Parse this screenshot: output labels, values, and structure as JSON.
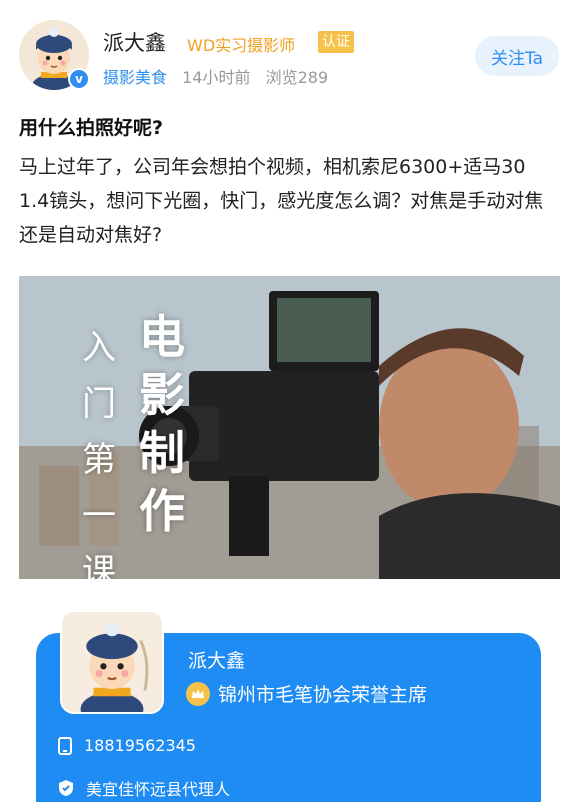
{
  "author": {
    "name": "派大鑫",
    "title": "WD实习摄影师",
    "cert_tag": "认证",
    "verify_icon": "v",
    "category": "摄影美食",
    "time": "14小时前",
    "views": "浏览289"
  },
  "follow_label": "关注Ta",
  "post": {
    "title": "用什么拍照好呢?",
    "body": "马上过年了，公司年会想拍个视频，相机索尼6300+适马30 1.4镜头，想问下光圈，快门，感光度怎么调？对焦是手动对焦还是自动对焦好?"
  },
  "banner": {
    "big_chars": [
      "电",
      "影",
      "制",
      "作"
    ],
    "small_chars": [
      "入",
      "门",
      "第",
      "一",
      "课"
    ]
  },
  "card": {
    "name": "派大鑫",
    "honor": "锦州市毛笔协会荣誉主席",
    "phone": "18819562345",
    "role": "美宜佳怀远县代理人"
  },
  "colors": {
    "accent": "#2f8ff0",
    "card_bg": "#1f8cf3",
    "title_orange": "#f0a020",
    "cert_yellow": "#f6c24a"
  },
  "icons": [
    "verified-badge-icon",
    "crown-icon",
    "phone-icon",
    "shield-icon"
  ]
}
